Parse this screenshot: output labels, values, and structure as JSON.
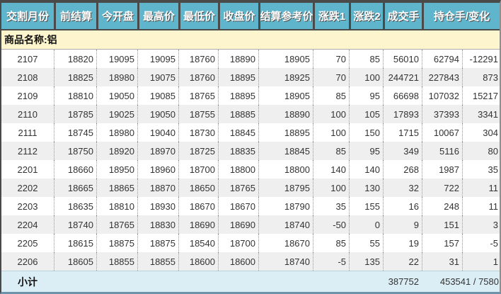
{
  "colors": {
    "header_bg": "#5fb5cb",
    "header_text": "#ffffff",
    "commodity_row_bg": "#fcf5cd",
    "subtotal_row_bg": "#dceef5",
    "row_alt_bg": "#efefef",
    "border_dark": "#4a4a4a",
    "bottom_border": "#6e93a9"
  },
  "table": {
    "headers": [
      "交割月份",
      "前结算",
      "今开盘",
      "最高价",
      "最低价",
      "收盘价",
      "结算参考价",
      "涨跌1",
      "涨跌2",
      "成交手",
      "持仓手/变化"
    ],
    "commodity_label": "商品名称:铝",
    "rows": [
      [
        "2107",
        "18820",
        "19095",
        "19095",
        "18760",
        "18890",
        "18905",
        "70",
        "85",
        "56010",
        "62794",
        "-12291"
      ],
      [
        "2108",
        "18825",
        "18980",
        "19075",
        "18760",
        "18895",
        "18925",
        "70",
        "100",
        "244721",
        "227843",
        "873"
      ],
      [
        "2109",
        "18810",
        "19050",
        "19085",
        "18765",
        "18895",
        "18905",
        "85",
        "95",
        "66698",
        "107032",
        "15217"
      ],
      [
        "2110",
        "18785",
        "19025",
        "19050",
        "18755",
        "18885",
        "18890",
        "100",
        "105",
        "17893",
        "37393",
        "3341"
      ],
      [
        "2111",
        "18745",
        "18980",
        "19040",
        "18730",
        "18845",
        "18895",
        "100",
        "150",
        "1715",
        "10067",
        "304"
      ],
      [
        "2112",
        "18750",
        "18920",
        "18970",
        "18725",
        "18835",
        "18845",
        "85",
        "95",
        "349",
        "5116",
        "80"
      ],
      [
        "2201",
        "18660",
        "18950",
        "18960",
        "18700",
        "18800",
        "18800",
        "140",
        "140",
        "268",
        "1987",
        "35"
      ],
      [
        "2202",
        "18665",
        "18865",
        "18870",
        "18650",
        "18765",
        "18795",
        "100",
        "130",
        "32",
        "722",
        "11"
      ],
      [
        "2203",
        "18635",
        "18810",
        "18930",
        "18670",
        "18670",
        "18790",
        "35",
        "155",
        "16",
        "248",
        "11"
      ],
      [
        "2204",
        "18740",
        "18765",
        "18830",
        "18690",
        "18690",
        "18740",
        "-50",
        "0",
        "9",
        "151",
        "3"
      ],
      [
        "2205",
        "18615",
        "18875",
        "18875",
        "18540",
        "18700",
        "18670",
        "85",
        "55",
        "19",
        "157",
        "-5"
      ],
      [
        "2206",
        "18605",
        "18855",
        "18855",
        "18600",
        "18600",
        "18740",
        "-5",
        "135",
        "22",
        "31",
        "1"
      ]
    ],
    "subtotal": {
      "label": "小计",
      "volume_total": "387752",
      "open_interest_total": "453541 / 7580"
    }
  }
}
